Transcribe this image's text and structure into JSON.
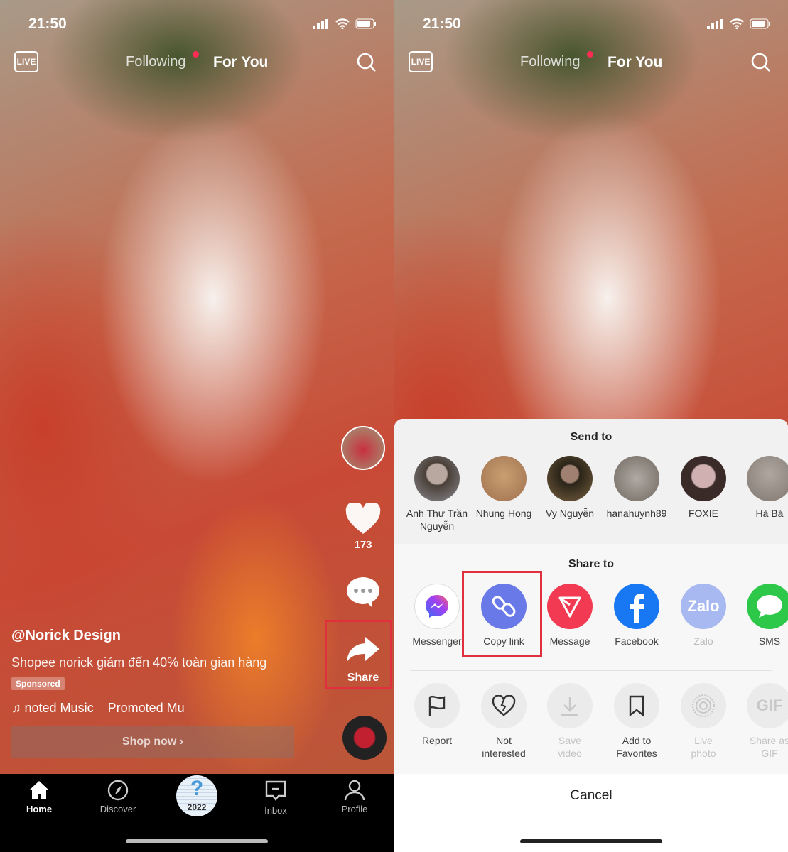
{
  "status": {
    "time": "21:50"
  },
  "topnav": {
    "live": "LIVE",
    "following": "Following",
    "for_you": "For You"
  },
  "left": {
    "likes": "173",
    "share_label": "Share",
    "author": "@Norick Design",
    "caption": "Shopee norick giảm đến 40% toàn gian hàng",
    "sponsored": "Sponsored",
    "music": "noted Music    Promoted Mu",
    "shop_now": "Shop now ›",
    "nav": [
      {
        "label": "Home",
        "icon": "home-icon"
      },
      {
        "label": "Discover",
        "icon": "compass-icon"
      },
      {
        "label": "2022",
        "icon": "question-badge-icon"
      },
      {
        "label": "Inbox",
        "icon": "inbox-icon"
      },
      {
        "label": "Profile",
        "icon": "person-icon"
      }
    ]
  },
  "sheet": {
    "send_to": "Send to",
    "contacts": [
      {
        "name": "Anh Thư Trần Nguyễn"
      },
      {
        "name": "Nhung Hong"
      },
      {
        "name": "Vy Nguyễn"
      },
      {
        "name": "hanahuynh89"
      },
      {
        "name": "FOXIE"
      },
      {
        "name": "Hà Bá"
      }
    ],
    "share_to": "Share to",
    "share_targets": [
      {
        "label": "Messenger",
        "color": "#ffffff"
      },
      {
        "label": "Copy link",
        "color": "#6979e8"
      },
      {
        "label": "Message",
        "color": "#f23a52"
      },
      {
        "label": "Facebook",
        "color": "#1877f2"
      },
      {
        "label": "Zalo",
        "color": "#a8b8f0"
      },
      {
        "label": "SMS",
        "color": "#2dc84a"
      }
    ],
    "actions": [
      {
        "label": "Report",
        "icon": "flag-icon"
      },
      {
        "label": "Not interested",
        "icon": "broken-heart-icon"
      },
      {
        "label": "Save video",
        "icon": "download-icon"
      },
      {
        "label": "Add to Favorites",
        "icon": "bookmark-icon"
      },
      {
        "label": "Live photo",
        "icon": "live-photo-icon"
      },
      {
        "label": "Share as GIF",
        "icon": "gif-icon"
      }
    ],
    "zalo_logo": "Zalo",
    "gif_logo": "GIF",
    "cancel": "Cancel"
  },
  "highlight_color": "#e0303e"
}
